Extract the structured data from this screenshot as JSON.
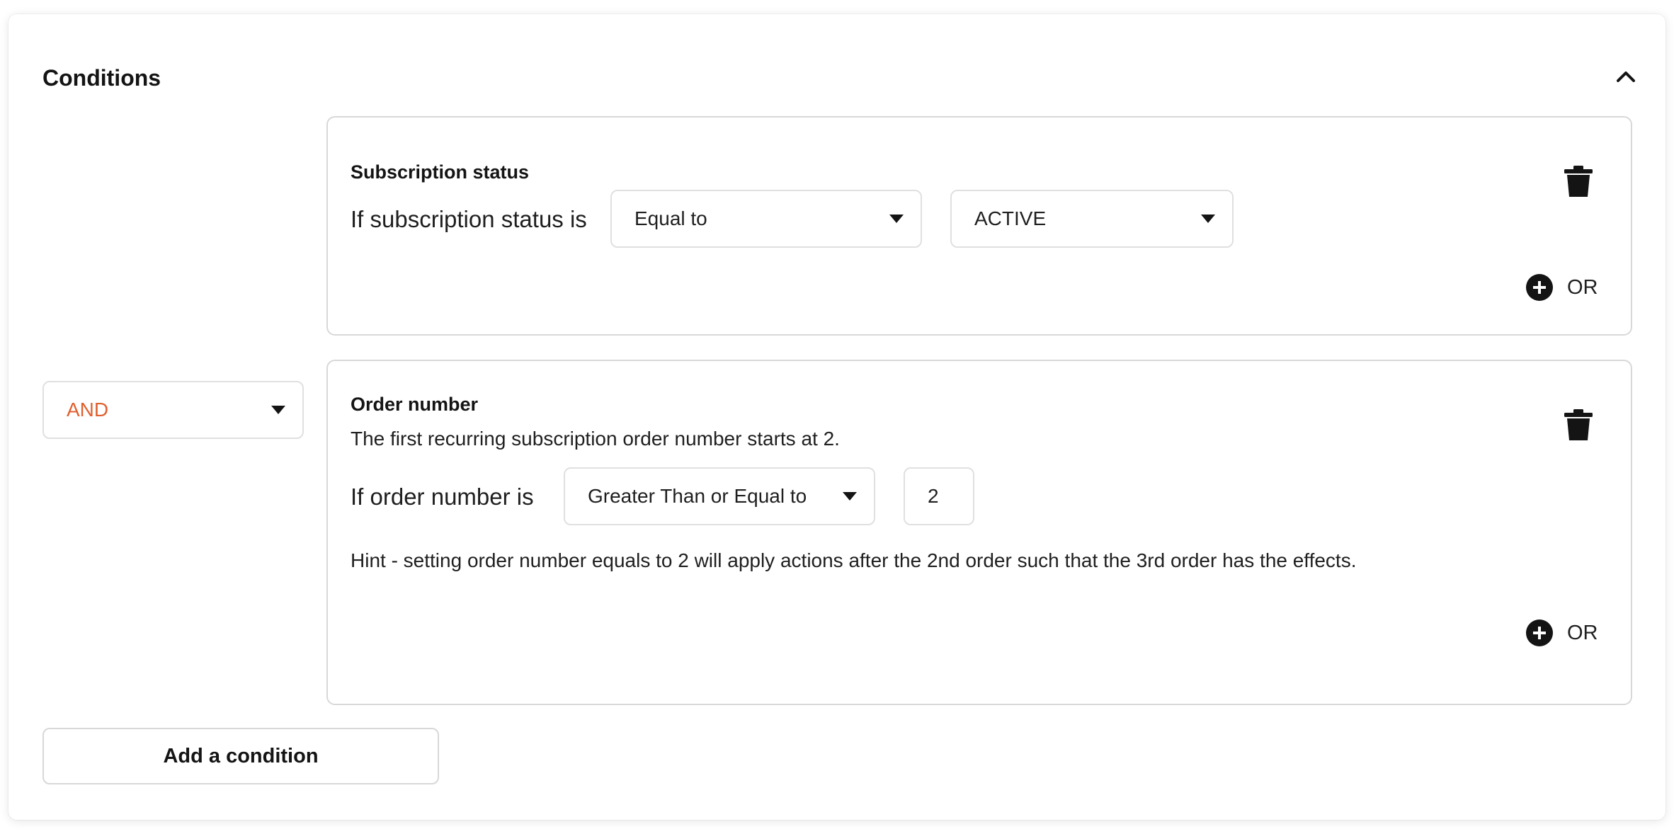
{
  "header": {
    "title": "Conditions",
    "collapse_icon": "chevron-up-icon"
  },
  "conditions": [
    {
      "title": "Subscription status",
      "label": "If subscription status is",
      "operator": "Equal to",
      "value": "ACTIVE",
      "or_label": "OR"
    },
    {
      "title": "Order number",
      "description": "The first recurring subscription order number starts at 2.",
      "label": "If order number is",
      "operator": "Greater Than or Equal to",
      "value": "2",
      "hint": "Hint - setting order number equals to 2 will apply actions after the 2nd order such that the 3rd order has the effects.",
      "or_label": "OR"
    }
  ],
  "logic": {
    "value": "AND",
    "color": "#e0602f"
  },
  "footer": {
    "add_label": "Add a condition"
  },
  "icons": {
    "delete": "trash-icon",
    "add": "plus-circle-icon",
    "dropdown": "caret-down-icon"
  }
}
